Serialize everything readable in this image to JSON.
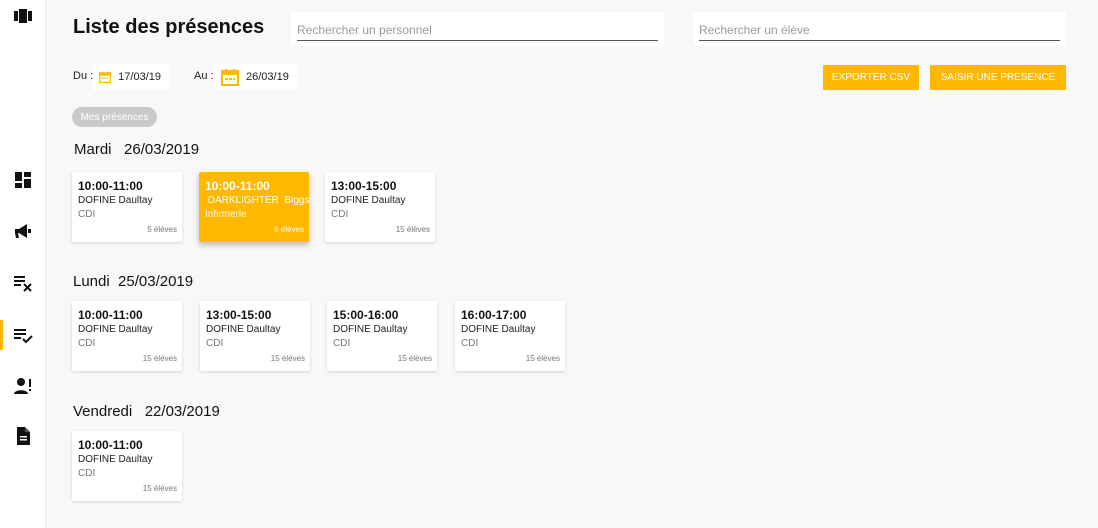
{
  "page": {
    "title": "Liste des présences"
  },
  "search": {
    "personnel_placeholder": "Rechercher un personnel",
    "eleve_placeholder": "Rechercher un élève"
  },
  "filters": {
    "from_label": "Du :",
    "from_date": "17/03/19",
    "to_label": "Au :",
    "to_date": "26/03/19"
  },
  "actions": {
    "export_label": "EXPORTER CSV",
    "add_label": "SAISIR UNE PRESENCE"
  },
  "chip": {
    "label": "Mes présences"
  },
  "colors": {
    "accent": "#FFB800"
  },
  "sidebar": {
    "icons": [
      "logo-icon",
      "dashboard-icon",
      "megaphone-icon",
      "list-remove-icon",
      "list-check-icon",
      "person-alert-icon",
      "document-icon"
    ],
    "active": "list-check-icon"
  },
  "days": [
    {
      "title": "Mardi   26/03/2019",
      "cards": [
        {
          "time": "10:00-11:00",
          "name": "DOFINE Daultay",
          "place": "CDI",
          "count": "5 élèves",
          "highlight": false
        },
        {
          "time": "10:00-11:00",
          "name": " DARKLIGHTER  Biggs",
          "place": "Infirmerie",
          "count": "6 élèves",
          "highlight": true
        },
        {
          "time": "13:00-15:00",
          "name": "DOFINE Daultay",
          "place": "CDI",
          "count": "15 élèves",
          "highlight": false
        }
      ]
    },
    {
      "title": "Lundi  25/03/2019",
      "cards": [
        {
          "time": "10:00-11:00",
          "name": "DOFINE Daultay",
          "place": "CDI",
          "count": "15 élèves",
          "highlight": false
        },
        {
          "time": "13:00-15:00",
          "name": "DOFINE Daultay",
          "place": "CDI",
          "count": "15 élèves",
          "highlight": false
        },
        {
          "time": "15:00-16:00",
          "name": "DOFINE Daultay",
          "place": "CDI",
          "count": "15 élèves",
          "highlight": false
        },
        {
          "time": "16:00-17:00",
          "name": "DOFINE Daultay",
          "place": "CDI",
          "count": "15 élèves",
          "highlight": false
        }
      ]
    },
    {
      "title": "Vendredi   22/03/2019",
      "cards": [
        {
          "time": "10:00-11:00",
          "name": "DOFINE Daultay",
          "place": "CDI",
          "count": "15 élèves",
          "highlight": false
        }
      ]
    }
  ]
}
